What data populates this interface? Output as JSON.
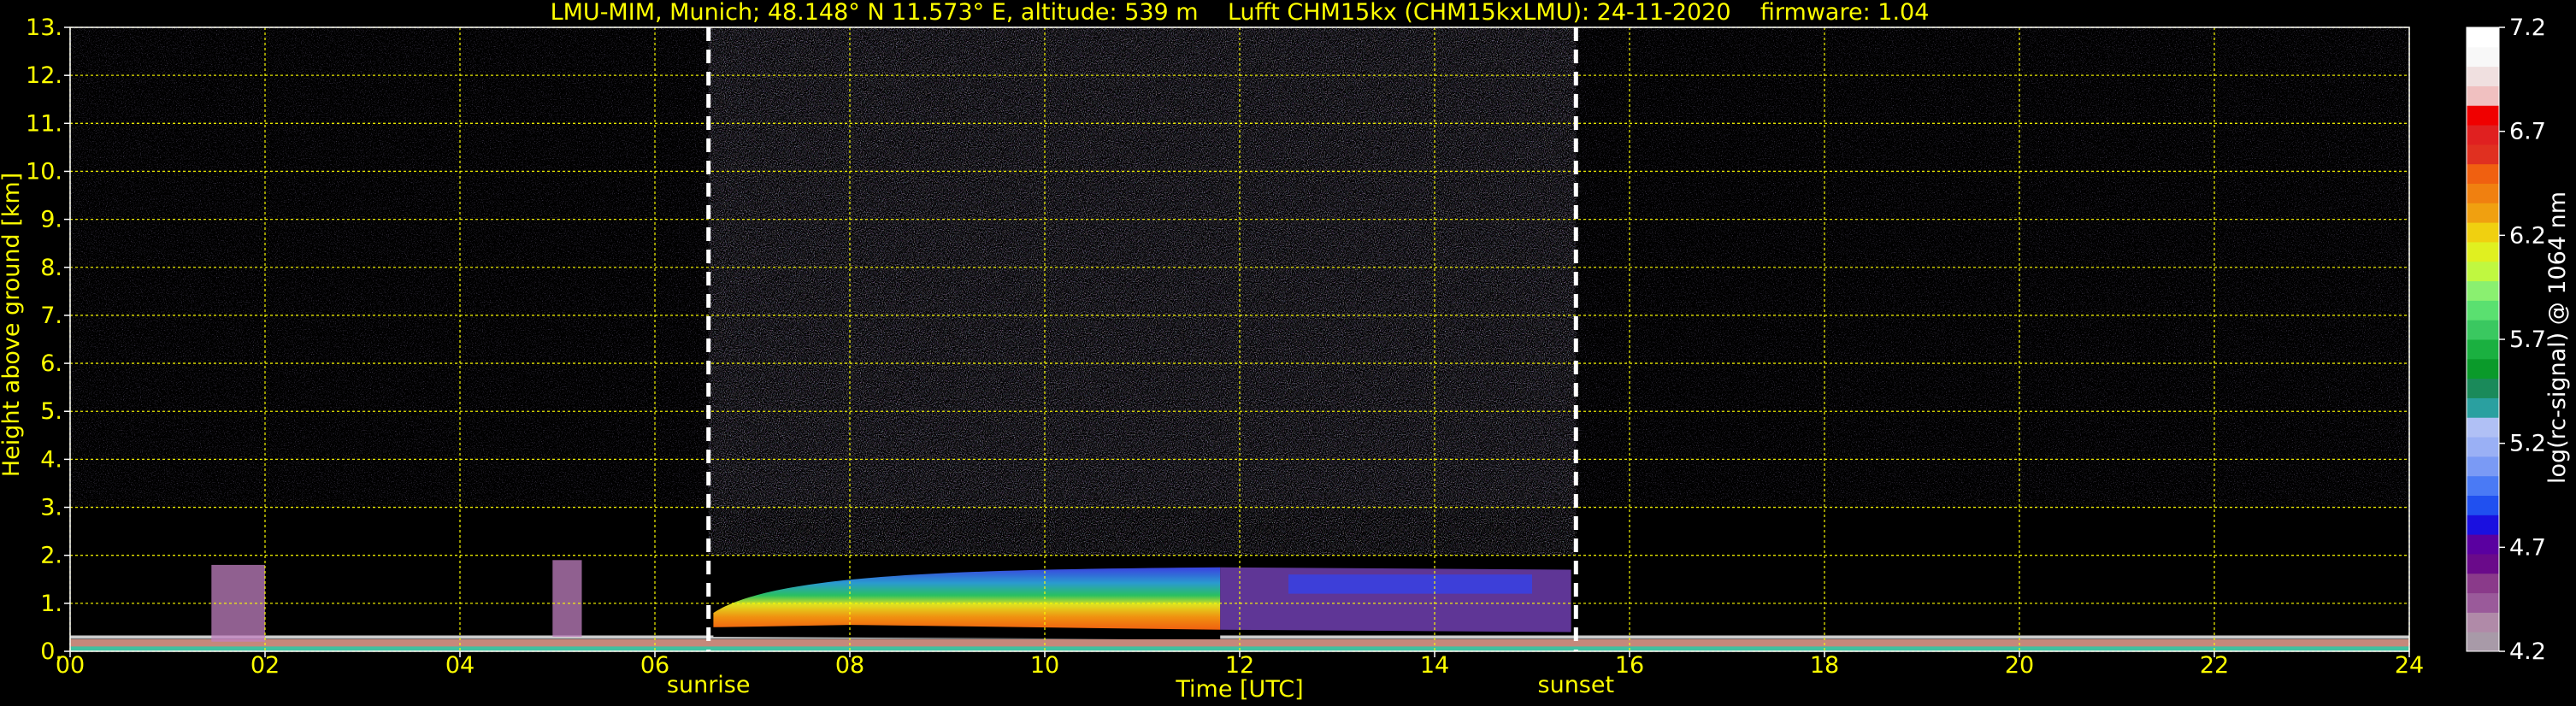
{
  "chart_data": {
    "type": "heatmap",
    "title": "LMU-MIM, Munich; 48.148° N 11.573° E, altitude: 539 m    Lufft CHM15kx (CHM15kxLMU): 24-11-2020    firmware: 1.04",
    "xlabel": "Time [UTC]",
    "ylabel": "Height above ground [km]",
    "xlim": [
      0,
      24
    ],
    "ylim": [
      0,
      13
    ],
    "x_ticks": [
      "00",
      "02",
      "04",
      "06",
      "08",
      "10",
      "12",
      "14",
      "16",
      "18",
      "20",
      "22",
      "24"
    ],
    "y_ticks": [
      "0.",
      "1.",
      "2.",
      "3.",
      "4.",
      "5.",
      "6.",
      "7.",
      "8.",
      "9.",
      "10.",
      "11.",
      "12.",
      "13."
    ],
    "grid": true,
    "grid_color": "#ffff00",
    "text_color": "#ffff00",
    "background": "#000000",
    "colorbar": {
      "label": "log(rc-signal) @ 1064 nm",
      "range": [
        4.2,
        7.2
      ],
      "ticks": [
        "4.2",
        "4.7",
        "5.2",
        "5.7",
        "6.2",
        "6.7",
        "7.2"
      ],
      "colors": [
        "#a89aa8",
        "#b08aa8",
        "#9a5a9a",
        "#8a3a8a",
        "#6a0a8a",
        "#5a00a0",
        "#1a10e0",
        "#2050f0",
        "#4a7af5",
        "#7a9af5",
        "#9ab0f5",
        "#b0c0f5",
        "#2aa0a0",
        "#1a8a5a",
        "#0a9a2a",
        "#1ab040",
        "#3ac860",
        "#5ae070",
        "#8af070",
        "#c0f840",
        "#e0f020",
        "#f0d010",
        "#f0a010",
        "#f08010",
        "#f06010",
        "#e03020",
        "#e02020",
        "#f00000",
        "#f0c0c0",
        "#f0e0e0",
        "#f8f8f8",
        "#ffffff"
      ]
    },
    "events": [
      {
        "label": "sunrise",
        "time": 6.55
      },
      {
        "label": "sunset",
        "time": 15.45
      }
    ],
    "aerosol_layer": {
      "start": 6.6,
      "end": 15.4,
      "top_km": 1.8,
      "base_km": 0.2
    },
    "cloud_patches": [
      {
        "start": 1.45,
        "end": 2.0,
        "bottom_km": 0.2,
        "top_km": 1.8
      },
      {
        "start": 4.95,
        "end": 5.25,
        "bottom_km": 0.3,
        "top_km": 1.9
      }
    ]
  }
}
